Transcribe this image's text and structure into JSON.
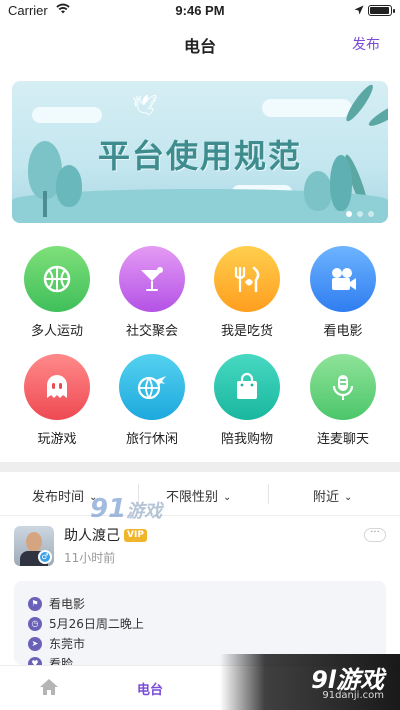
{
  "status_bar": {
    "carrier": "Carrier",
    "time": "9:46 PM",
    "battery_level": 0.95
  },
  "nav": {
    "title": "电台",
    "publish_label": "发布"
  },
  "banner": {
    "text": "平台使用规范",
    "dots": 3,
    "active_dot": 1
  },
  "categories": [
    {
      "label": "多人运动",
      "icon": "basketball-icon",
      "color_from": "#7fe07a",
      "color_to": "#3fbf5a"
    },
    {
      "label": "社交聚会",
      "icon": "cocktail-icon",
      "color_from": "#e49bf4",
      "color_to": "#b452e6"
    },
    {
      "label": "我是吃货",
      "icon": "food-icon",
      "color_from": "#ffcf4d",
      "color_to": "#ff9e1f"
    },
    {
      "label": "看电影",
      "icon": "movie-camera-icon",
      "color_from": "#6db4ff",
      "color_to": "#2f7df0"
    },
    {
      "label": "玩游戏",
      "icon": "ghost-icon",
      "color_from": "#ff8a8a",
      "color_to": "#ee4a53"
    },
    {
      "label": "旅行休闲",
      "icon": "travel-icon",
      "color_from": "#55d2f0",
      "color_to": "#1da8dd"
    },
    {
      "label": "陪我购物",
      "icon": "shopping-bag-icon",
      "color_from": "#48d8c2",
      "color_to": "#19b79e"
    },
    {
      "label": "连麦聊天",
      "icon": "microphone-icon",
      "color_from": "#8fe39a",
      "color_to": "#4cc66a"
    }
  ],
  "filters": [
    {
      "label": "发布时间"
    },
    {
      "label": "不限性别"
    },
    {
      "label": "附近"
    }
  ],
  "post": {
    "name": "助人渡己",
    "badge": "VIP",
    "ago": "11小时前",
    "more": "···",
    "details": [
      {
        "icon": "flag-icon",
        "text": "看电影"
      },
      {
        "icon": "clock-icon",
        "text": "5月26日周二晚上"
      },
      {
        "icon": "location-icon",
        "text": "东莞市"
      },
      {
        "icon": "heart-icon",
        "text": "看脸"
      }
    ]
  },
  "tabbar": {
    "home_label": "",
    "radio_label": "电台"
  },
  "watermarks": {
    "top_number": "91",
    "top_text": "游戏",
    "corner_number": "9l",
    "corner_text": "游戏",
    "corner_url": "91danji.com"
  },
  "colors": {
    "accent": "#7b4cd8"
  }
}
